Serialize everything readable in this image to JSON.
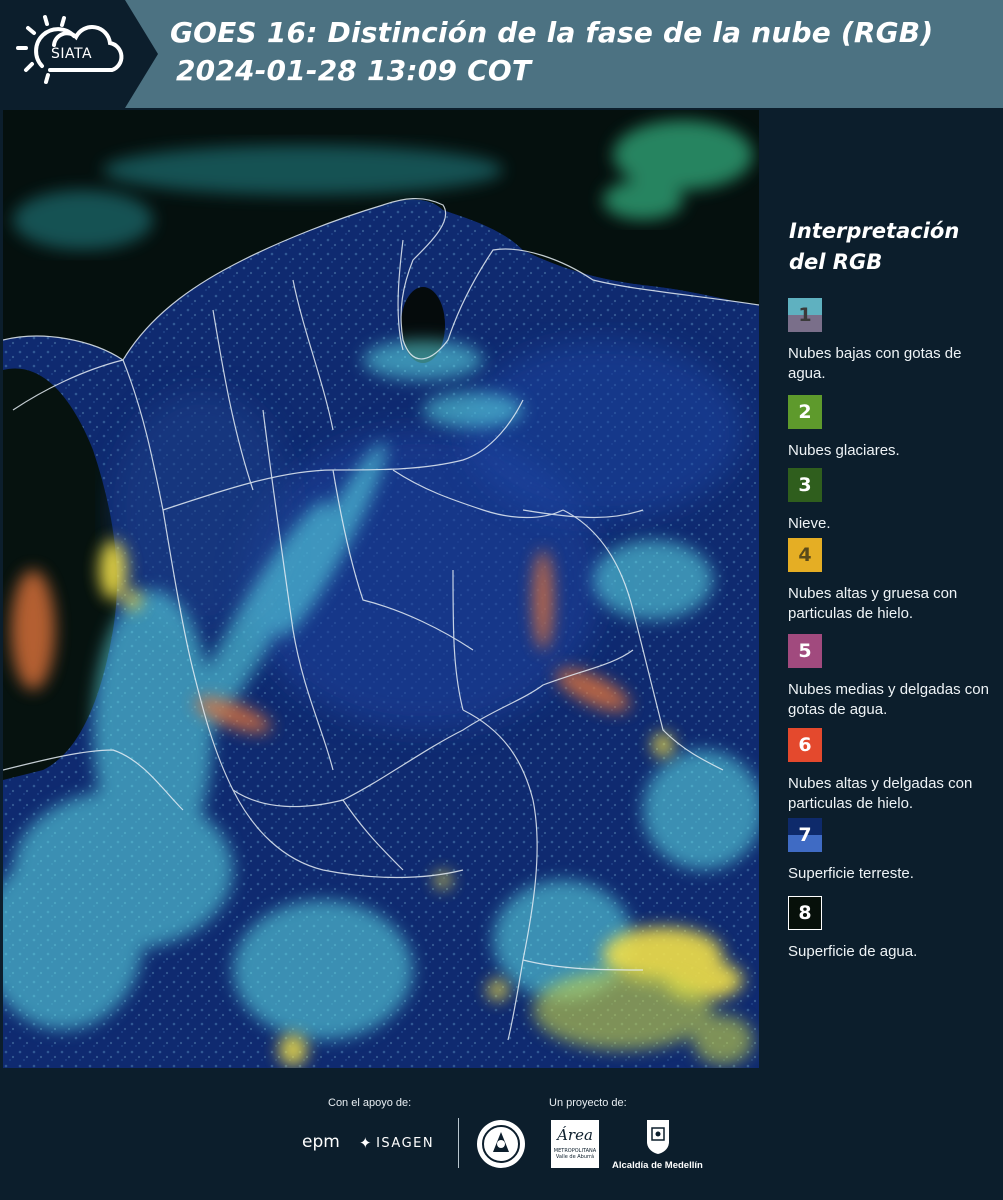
{
  "header": {
    "logo_text": "SIATA",
    "title_line1": "GOES 16: Distinción de la fase de la nube (RGB)",
    "title_line2": "2024-01-28 13:09 COT"
  },
  "legend": {
    "title_line1": "Interpretación",
    "title_line2": "del RGB",
    "items": [
      {
        "number": "1",
        "label": "Nubes bajas con gotas de agua.",
        "color_top": "#5fb1c0",
        "color_bottom": "#7a6f8a",
        "text_color": "#3a3a3a"
      },
      {
        "number": "2",
        "label": "Nubes glaciares.",
        "color_top": "#5e9a2c",
        "color_bottom": "#5e9a2c",
        "text_color": "#ffffff"
      },
      {
        "number": "3",
        "label": "Nieve.",
        "color_top": "#2f5e1d",
        "color_bottom": "#2f5e1d",
        "text_color": "#ffffff"
      },
      {
        "number": "4",
        "label": "Nubes altas y gruesa con particulas de hielo.",
        "color_top": "#e5ae24",
        "color_bottom": "#e5ae24",
        "text_color": "#5a4a1a"
      },
      {
        "number": "5",
        "label": "Nubes medias y delgadas con gotas de agua.",
        "color_top": "#a14a7e",
        "color_bottom": "#a14a7e",
        "text_color": "#ffffff"
      },
      {
        "number": "6",
        "label": "Nubes altas y delgadas con particulas de hielo.",
        "color_top": "#e4492d",
        "color_bottom": "#e4492d",
        "text_color": "#ffffff"
      },
      {
        "number": "7",
        "label": "Superficie terreste.",
        "color_top": "#0e2a6b",
        "color_bottom": "#3f6bc4",
        "text_color": "#ffffff"
      },
      {
        "number": "8",
        "label": "Superficie de agua.",
        "color_top": "#07100a",
        "color_bottom": "#07100a",
        "text_color": "#ffffff"
      }
    ]
  },
  "footer": {
    "support_label": "Con el apoyo de:",
    "project_label": "Un proyecto de:",
    "sponsor1": "epm",
    "sponsor2": "ISAGEN",
    "partner_area_top": "Área",
    "partner_area_line1": "METROPOLITANA",
    "partner_area_line2": "Valle de Aburrá",
    "partner_medellin": "Alcaldía de Medellín"
  },
  "colors": {
    "header_bg": "#4c7282",
    "panel_bg": "#0c1e2c"
  }
}
